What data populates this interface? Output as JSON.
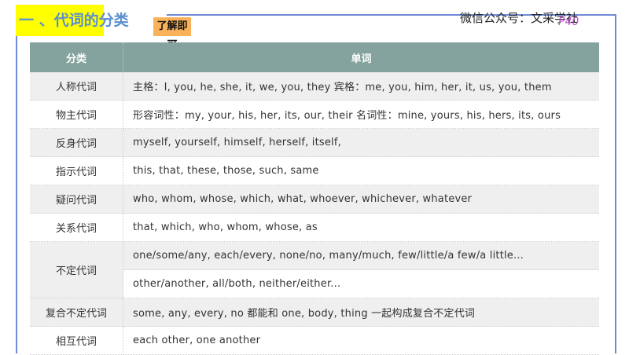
{
  "header": {
    "title": "一 、代词的分类",
    "badge": "了解即可",
    "wechat": "微信公众号：文采学社",
    "page_mark": "P40"
  },
  "table": {
    "columns": [
      "分类",
      "单词"
    ],
    "rows": [
      {
        "category": "人称代词",
        "words": [
          "主格：I, you, he, she, it, we, you, they 宾格：me, you, him, her, it, us, you, them"
        ]
      },
      {
        "category": "物主代词",
        "words": [
          "形容词性：my, your, his, her, its, our, their 名词性：mine, yours, his, hers, its, ours"
        ]
      },
      {
        "category": "反身代词",
        "words": [
          "myself, yourself, himself, herself, itself,"
        ]
      },
      {
        "category": "指示代词",
        "words": [
          "this, that, these, those, such, same"
        ]
      },
      {
        "category": "疑问代词",
        "words": [
          "who, whom, whose, which, what, whoever, whichever, whatever"
        ]
      },
      {
        "category": "关系代词",
        "words": [
          "that, which, who, whom, whose, as"
        ]
      },
      {
        "category": "不定代词",
        "words": [
          "one/some/any, each/every, none/no, many/much, few/little/a few/a little...",
          "other/another, all/both, neither/either..."
        ]
      },
      {
        "category": "复合不定代词",
        "words": [
          "some, any, every, no 都能和 one, body, thing 一起构成复合不定代词"
        ]
      },
      {
        "category": "相互代词",
        "words": [
          "each other, one another"
        ]
      }
    ]
  }
}
